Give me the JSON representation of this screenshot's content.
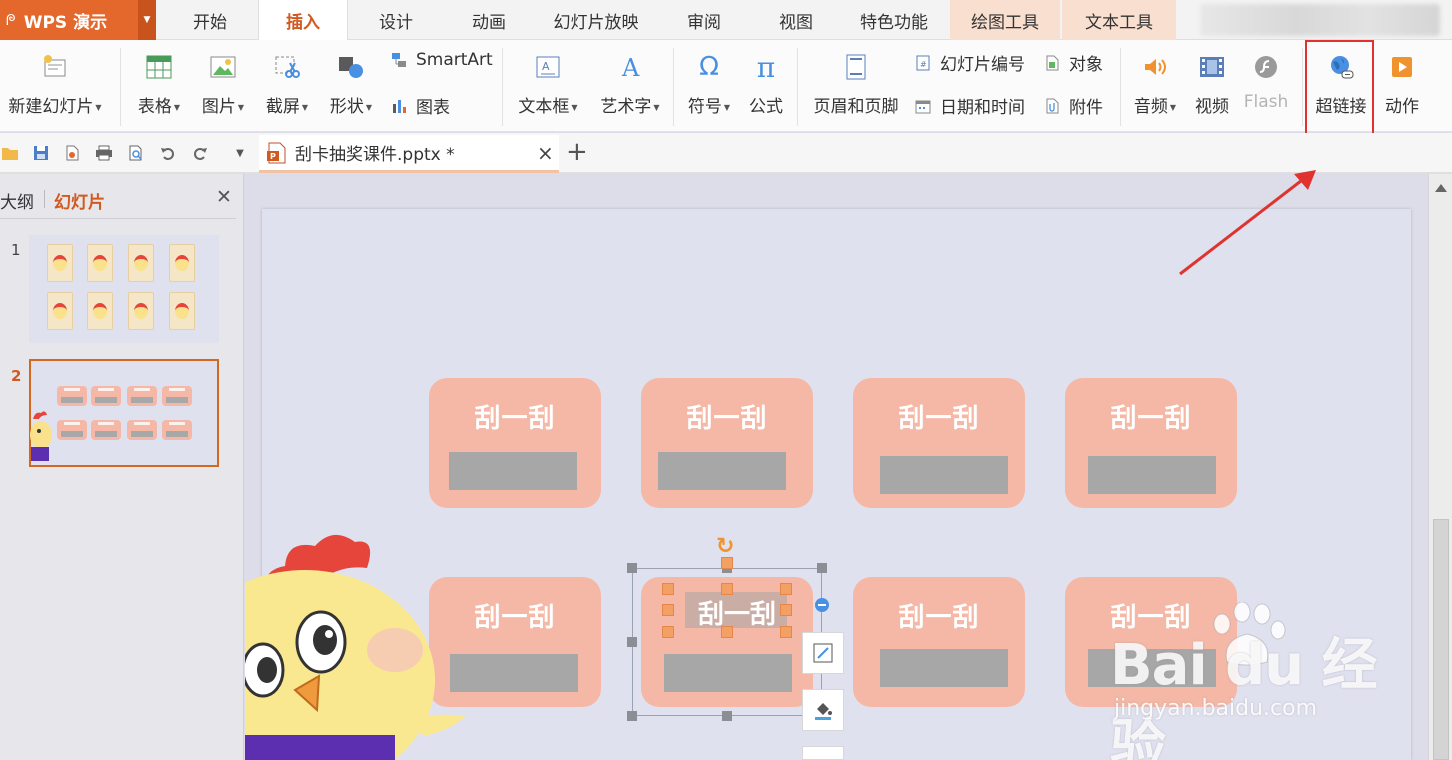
{
  "app": {
    "name": "WPS 演示"
  },
  "menu_tabs": [
    "开始",
    "插入",
    "设计",
    "动画",
    "幻灯片放映",
    "审阅",
    "视图",
    "特色功能",
    "绘图工具",
    "文本工具"
  ],
  "ribbon": {
    "new_slide": "新建幻灯片",
    "table": "表格",
    "picture": "图片",
    "screenshot": "截屏",
    "shape": "形状",
    "smartart": "SmartArt",
    "chart": "图表",
    "textbox": "文本框",
    "wordart": "艺术字",
    "symbol": "符号",
    "formula": "公式",
    "header_footer": "页眉和页脚",
    "slide_number": "幻灯片编号",
    "date_time": "日期和时间",
    "object": "对象",
    "attachment": "附件",
    "audio": "音频",
    "video": "视频",
    "flash": "Flash",
    "hyperlink": "超链接",
    "action": "动作"
  },
  "document": {
    "tab_title": "刮卡抽奖课件.pptx *"
  },
  "side_panel": {
    "tab_outline": "大纲",
    "tab_slides": "幻灯片",
    "slide_numbers": [
      "1",
      "2"
    ]
  },
  "slide": {
    "cards": [
      "刮一刮",
      "刮一刮",
      "刮一刮",
      "刮一刮",
      "刮一刮",
      "刮一刮",
      "刮一刮",
      "刮一刮"
    ]
  },
  "watermark": {
    "main": "Bai du 经验",
    "sub": "jingyan.baidu.com"
  },
  "colors": {
    "accent": "#d2591f",
    "app_badge": "#e4672b",
    "card": "#f5b8a6",
    "scratch": "#a7a7a7",
    "highlight": "#e0332f"
  }
}
